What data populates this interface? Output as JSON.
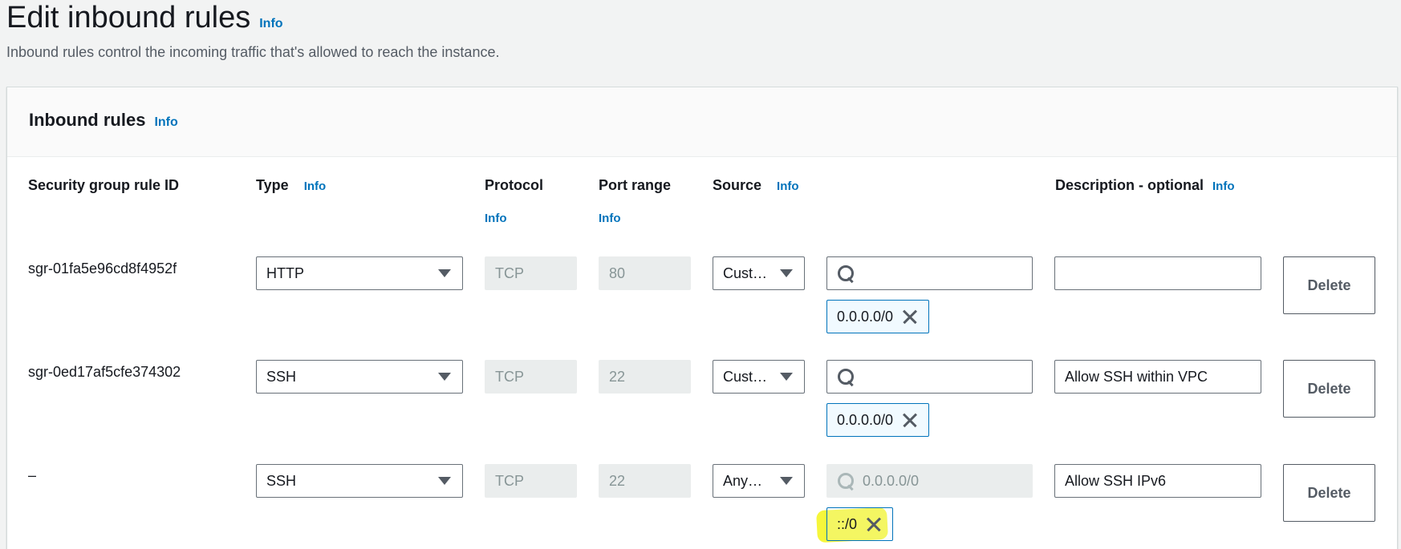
{
  "page": {
    "title": "Edit inbound rules",
    "title_info": "Info",
    "subtitle": "Inbound rules control the incoming traffic that's allowed to reach the instance."
  },
  "panel": {
    "title": "Inbound rules",
    "title_info": "Info"
  },
  "columns": {
    "rule_id": "Security group rule ID",
    "type": "Type",
    "type_info": "Info",
    "protocol": "Protocol",
    "protocol_info": "Info",
    "port_range": "Port range",
    "port_range_info": "Info",
    "source": "Source",
    "source_info": "Info",
    "description": "Description - optional",
    "description_info": "Info"
  },
  "rules": [
    {
      "rule_id": "sgr-01fa5e96cd8f4952f",
      "type": "HTTP",
      "protocol": "TCP",
      "port_range": "80",
      "source_type": "Cust…",
      "search_placeholder": "",
      "token": "0.0.0.0/0",
      "description": "",
      "delete_label": "Delete"
    },
    {
      "rule_id": "sgr-0ed17af5cfe374302",
      "type": "SSH",
      "protocol": "TCP",
      "port_range": "22",
      "source_type": "Cust…",
      "search_placeholder": "",
      "token": "0.0.0.0/0",
      "description": "Allow SSH within VPC",
      "delete_label": "Delete"
    },
    {
      "rule_id": "–",
      "type": "SSH",
      "protocol": "TCP",
      "port_range": "22",
      "source_type": "Any…",
      "search_placeholder": "0.0.0.0/0",
      "token": "::/0",
      "description": "Allow SSH IPv6",
      "delete_label": "Delete"
    }
  ],
  "colors": {
    "link": "#0073bb",
    "token_bg": "#f1faff",
    "highlight": "#f4f419"
  }
}
